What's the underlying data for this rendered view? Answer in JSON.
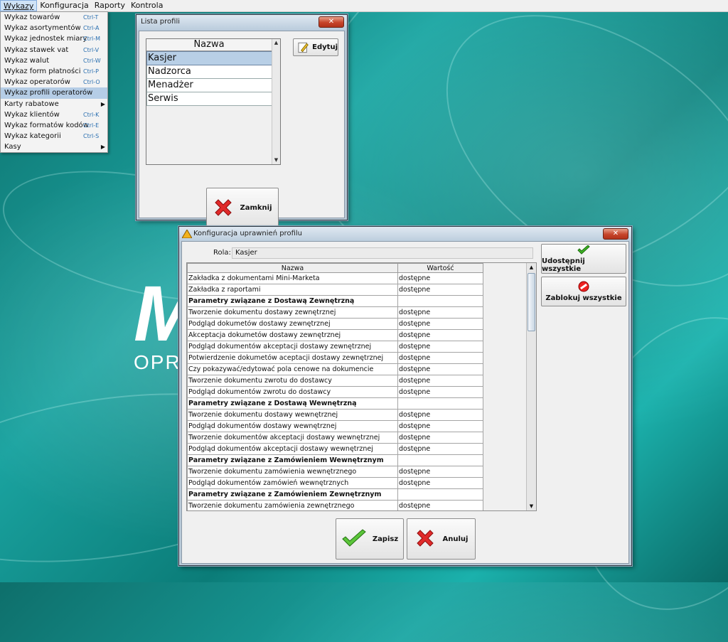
{
  "menubar": [
    "Wykazy",
    "Konfiguracja",
    "Raporty",
    "Kontrola"
  ],
  "menu": [
    {
      "label": "Wykaz towarów",
      "shortcut": "Ctrl-T"
    },
    {
      "label": "Wykaz asortymentów",
      "shortcut": "Ctrl-A"
    },
    {
      "label": "Wykaz jednostek miary",
      "shortcut": "Ctrl-M"
    },
    {
      "label": "Wykaz stawek vat",
      "shortcut": "Ctrl-V"
    },
    {
      "label": "Wykaz walut",
      "shortcut": "Ctrl-W"
    },
    {
      "label": "Wykaz form płatności",
      "shortcut": "Ctrl-P"
    },
    {
      "label": "Wykaz operatorów",
      "shortcut": "Ctrl-O"
    },
    {
      "label": "Wykaz profili operatorów",
      "shortcut": ""
    },
    {
      "label": "Karty rabatowe",
      "shortcut": "",
      "submenu": true
    },
    {
      "label": "Wykaz klientów",
      "shortcut": "Ctrl-K"
    },
    {
      "label": "Wykaz formatów kodów",
      "shortcut": "Ctrl-E"
    },
    {
      "label": "Wykaz kategorii",
      "shortcut": "Ctrl-S"
    },
    {
      "label": "Kasy",
      "shortcut": "",
      "submenu": true
    }
  ],
  "background": {
    "logo_big": "M",
    "logo_sub": "OPR"
  },
  "profiles_window": {
    "title": "Lista profili",
    "header": "Nazwa",
    "items": [
      "Kasjer",
      "Nadzorca",
      "Menadżer",
      "Serwis"
    ],
    "edit_label": "Edytuj",
    "close_label": "Zamknij"
  },
  "perm_window": {
    "title": "Konfiguracja uprawnień profilu",
    "role_label": "Rola:",
    "role_value": "Kasjer",
    "col_name": "Nazwa",
    "col_value": "Wartość",
    "share_all": "Udostępnij wszystkie",
    "block_all": "Zablokuj wszystkie",
    "save": "Zapisz",
    "cancel": "Anuluj",
    "rows": [
      {
        "name": "Zakładka z dokumentami Mini-Marketa",
        "value": "dostępne"
      },
      {
        "name": "Zakładka z raportami",
        "value": "dostępne"
      },
      {
        "name": "Parametry związane z Dostawą Zewnętrzną",
        "value": "",
        "group": true
      },
      {
        "name": "Tworzenie dokumentu dostawy zewnętrznej",
        "value": "dostępne"
      },
      {
        "name": "Podgląd dokumetów dostawy zewnętrznej",
        "value": "dostępne"
      },
      {
        "name": "Akceptacja dokumetów dostawy zewnętrznej",
        "value": "dostępne"
      },
      {
        "name": "Podgląd dokumentów akceptacji dostawy zewnętrznej",
        "value": "dostępne"
      },
      {
        "name": "Potwierdzenie dokumetów aceptacji dostawy zewnętrznej",
        "value": "dostępne"
      },
      {
        "name": "Czy pokazywać/edytować pola cenowe na dokumencie",
        "value": "dostępne"
      },
      {
        "name": "Tworzenie dokumentu zwrotu do dostawcy",
        "value": "dostępne"
      },
      {
        "name": "Podgląd dokumentów zwrotu do dostawcy",
        "value": "dostępne"
      },
      {
        "name": "Parametry związane z Dostawą Wewnętrzną",
        "value": "",
        "group": true
      },
      {
        "name": "Tworzenie dokumentu dostawy wewnętrznej",
        "value": "dostępne"
      },
      {
        "name": "Podgląd dokumentów dostawy wewnętrznej",
        "value": "dostępne"
      },
      {
        "name": "Tworzenie dokumentów akceptacji dostawy wewnętrznej",
        "value": "dostępne"
      },
      {
        "name": "Podgląd dokumentów akceptacji dostawy wewnętrznej",
        "value": "dostępne"
      },
      {
        "name": "Parametry związane z Zamówieniem Wewnętrznym",
        "value": "",
        "group": true
      },
      {
        "name": "Tworzenie dokumentu zamówienia wewnętrznego",
        "value": "dostępne"
      },
      {
        "name": "Podgląd dokumentów zamówień wewnętrznych",
        "value": "dostępne"
      },
      {
        "name": "Parametry związane z Zamówieniem Zewnętrznym",
        "value": "",
        "group": true
      },
      {
        "name": "Tworzenie dokumentu zamówienia zewnętrznego",
        "value": "dostępne"
      }
    ]
  },
  "colors": {
    "accent": "#b5cde6",
    "desktop": "#1aa3a0",
    "close": "#c6442a"
  }
}
